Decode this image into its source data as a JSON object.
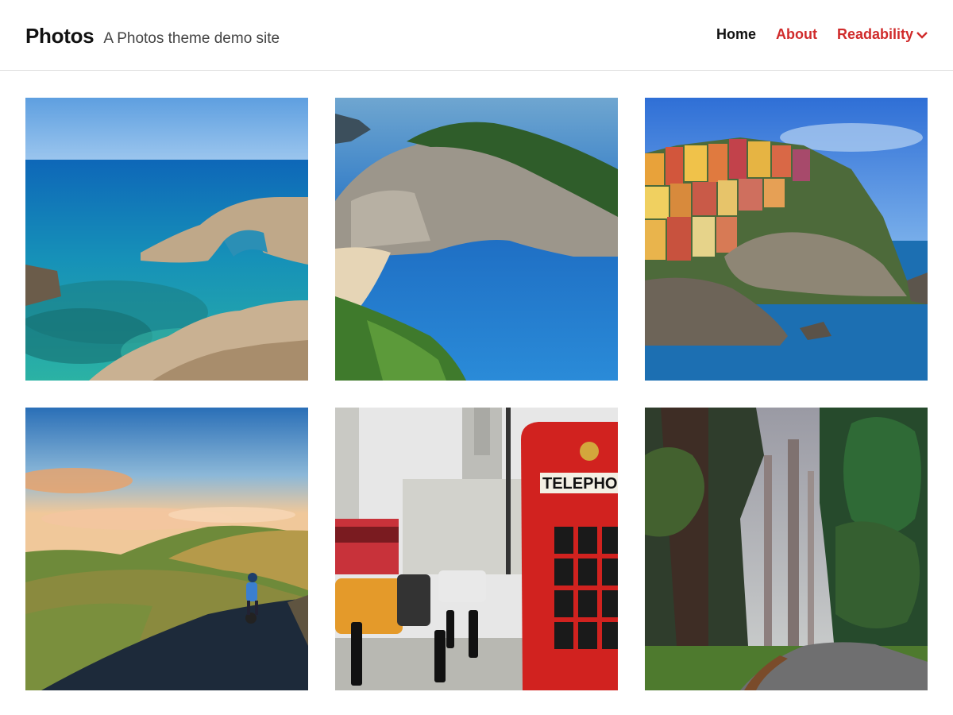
{
  "header": {
    "site_title": "Photos",
    "site_description": "A Photos theme demo site"
  },
  "nav": {
    "items": [
      {
        "label": "Home"
      },
      {
        "label": "About"
      },
      {
        "label": "Readability",
        "icon": "chevron-down-icon"
      }
    ]
  },
  "colors": {
    "accent": "#d02b2b",
    "text": "#111111",
    "border": "#dedede"
  },
  "gallery": {
    "photos": [
      {
        "subject": "turquoise sea with rock arch"
      },
      {
        "subject": "cliff cove with blue water and beach"
      },
      {
        "subject": "colorful cliffside village by the sea"
      },
      {
        "subject": "cyclist on road through green hills"
      },
      {
        "subject": "red telephone box on city street"
      },
      {
        "subject": "misty forest road"
      }
    ],
    "sign_text": "TELEPHO"
  }
}
